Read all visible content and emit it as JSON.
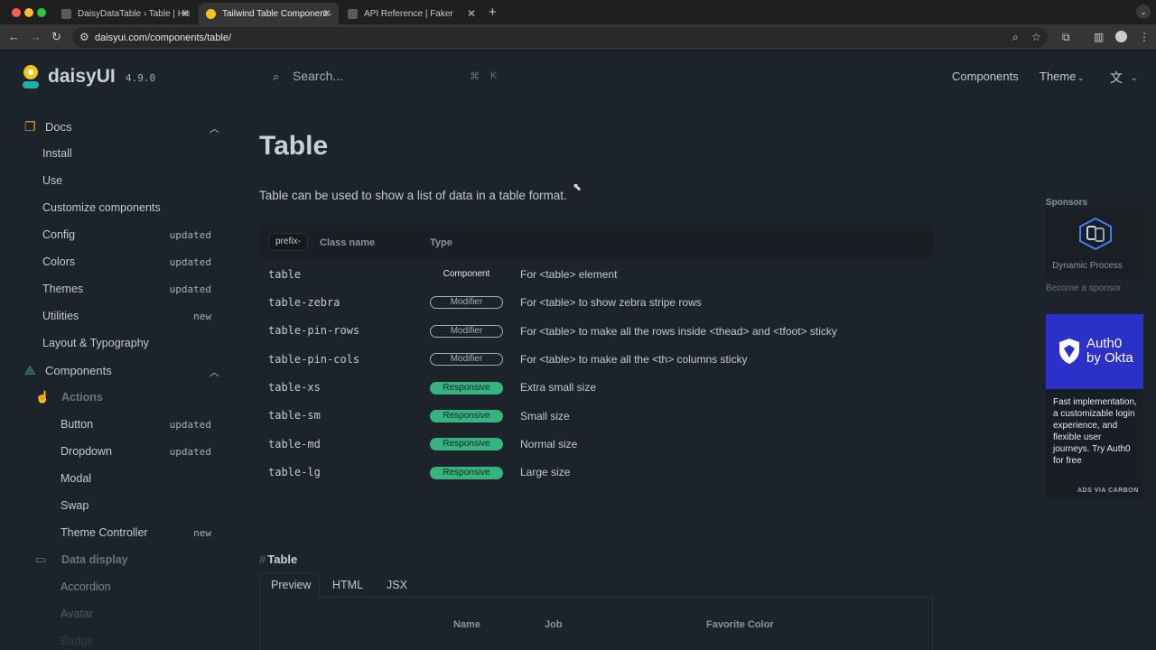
{
  "browser": {
    "tabs": [
      {
        "title": "DaisyDataTable › Table | Histo",
        "active": false
      },
      {
        "title": "Tailwind Table Component —",
        "active": true
      },
      {
        "title": "API Reference | Faker",
        "active": false
      }
    ],
    "url": "daisyui.com/components/table/"
  },
  "header": {
    "brand": "daisyUI",
    "version": "4.9.0",
    "search_placeholder": "Search...",
    "shortcut": [
      "⌘",
      "K"
    ],
    "nav": {
      "components": "Components",
      "theme": "Theme"
    }
  },
  "sidebar": {
    "docs_label": "Docs",
    "docs_items": [
      {
        "label": "Install",
        "badge": ""
      },
      {
        "label": "Use",
        "badge": ""
      },
      {
        "label": "Customize components",
        "badge": ""
      },
      {
        "label": "Config",
        "badge": "updated"
      },
      {
        "label": "Colors",
        "badge": "updated"
      },
      {
        "label": "Themes",
        "badge": "updated"
      },
      {
        "label": "Utilities",
        "badge": "new"
      },
      {
        "label": "Layout & Typography",
        "badge": ""
      }
    ],
    "components_label": "Components",
    "actions_label": "Actions",
    "actions_items": [
      {
        "label": "Button",
        "badge": "updated"
      },
      {
        "label": "Dropdown",
        "badge": "updated"
      },
      {
        "label": "Modal",
        "badge": ""
      },
      {
        "label": "Swap",
        "badge": ""
      },
      {
        "label": "Theme Controller",
        "badge": "new"
      }
    ],
    "data_display_label": "Data display",
    "data_display_items": [
      {
        "label": "Accordion"
      },
      {
        "label": "Avatar"
      },
      {
        "label": "Badge"
      }
    ]
  },
  "main": {
    "title": "Table",
    "lead": "Table can be used to show a list of data in a table format.",
    "table_headers": {
      "prefix": "prefix-",
      "class_name": "Class name",
      "type": "Type"
    },
    "rows": [
      {
        "cls": "table",
        "type": "Component",
        "kind": "component",
        "desc": "For <table> element"
      },
      {
        "cls": "table-zebra",
        "type": "Modifier",
        "kind": "modifier",
        "desc": "For <table> to show zebra stripe rows"
      },
      {
        "cls": "table-pin-rows",
        "type": "Modifier",
        "kind": "modifier",
        "desc": "For <table> to make all the rows inside <thead> and <tfoot> sticky"
      },
      {
        "cls": "table-pin-cols",
        "type": "Modifier",
        "kind": "modifier",
        "desc": "For <table> to make all the <th> columns sticky"
      },
      {
        "cls": "table-xs",
        "type": "Responsive",
        "kind": "responsive",
        "desc": "Extra small size"
      },
      {
        "cls": "table-sm",
        "type": "Responsive",
        "kind": "responsive",
        "desc": "Small size"
      },
      {
        "cls": "table-md",
        "type": "Responsive",
        "kind": "responsive",
        "desc": "Normal size"
      },
      {
        "cls": "table-lg",
        "type": "Responsive",
        "kind": "responsive",
        "desc": "Large size"
      }
    ],
    "section_hash": "#",
    "section_title": "Table",
    "preview_tabs": [
      "Preview",
      "HTML",
      "JSX"
    ],
    "preview_headers": [
      "Name",
      "Job",
      "Favorite Color"
    ]
  },
  "rail": {
    "sponsors_label": "Sponsors",
    "sponsor_name": "Dynamic Process",
    "become_sponsor": "Become a sponsor",
    "ad_logo_line1": "Auth0",
    "ad_logo_line2": "by Okta",
    "ad_text": "Fast implementation, a customizable login experience, and flexible user journeys. Try Auth0 for free",
    "ad_via": "ADS VIA CARBON"
  },
  "colors": {
    "background": "#1d232a",
    "accent": "#36b37e",
    "ad_blue": "#2b30c9"
  }
}
